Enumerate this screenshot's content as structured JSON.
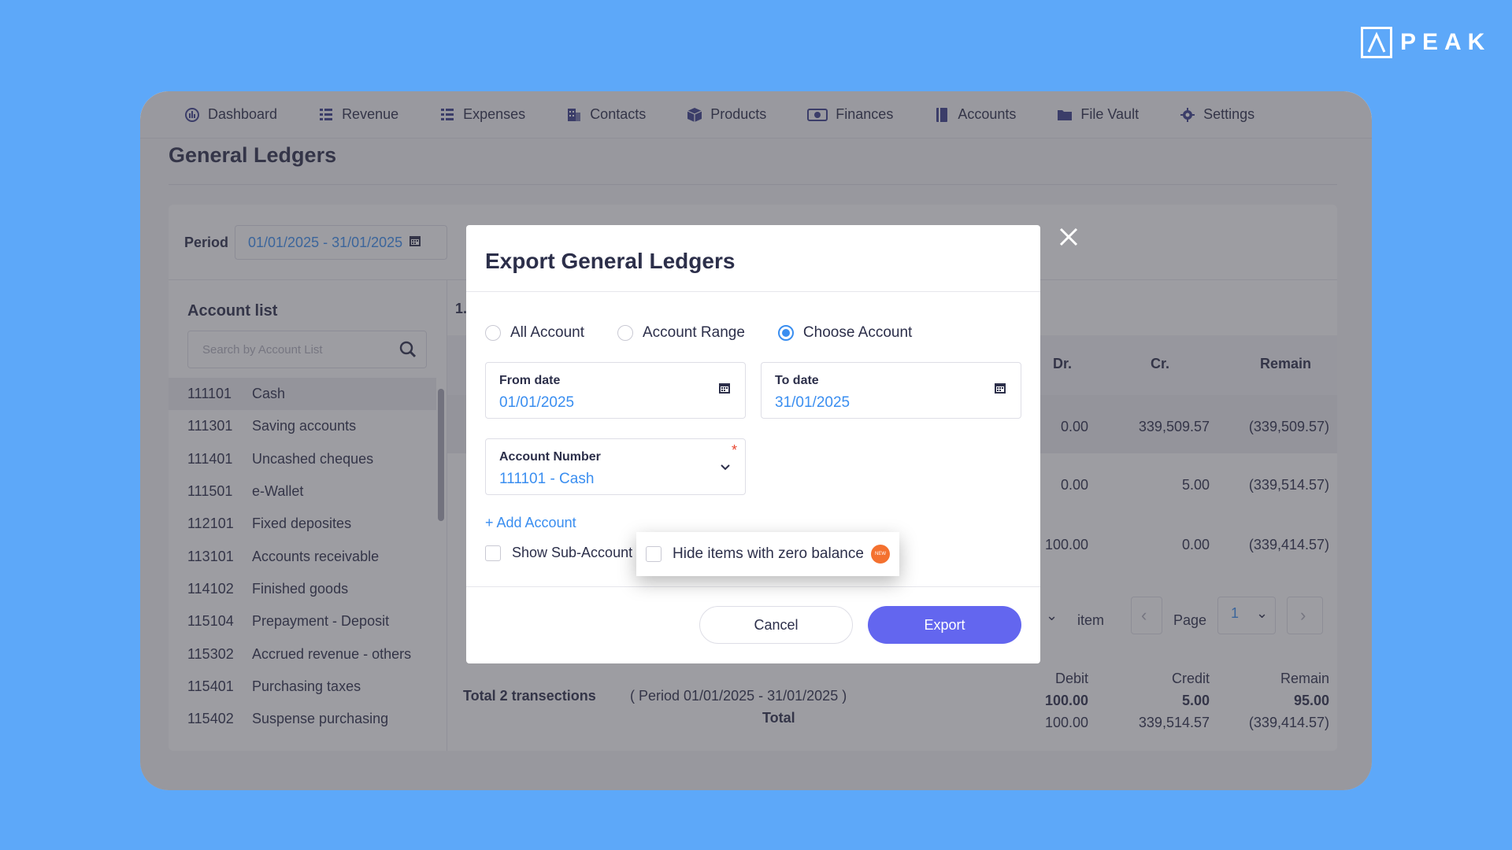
{
  "brand": {
    "logo_text": "PEAK",
    "background": "#5da8f9",
    "accent": "#6366ef",
    "link": "#3a8ef0"
  },
  "nav": {
    "items": [
      {
        "label": "Dashboard",
        "icon": "dashboard-icon"
      },
      {
        "label": "Revenue",
        "icon": "list-icon"
      },
      {
        "label": "Expenses",
        "icon": "list-icon"
      },
      {
        "label": "Contacts",
        "icon": "building-icon"
      },
      {
        "label": "Products",
        "icon": "box-icon"
      },
      {
        "label": "Finances",
        "icon": "money-icon"
      },
      {
        "label": "Accounts",
        "icon": "book-icon"
      },
      {
        "label": "File Vault",
        "icon": "folder-icon"
      },
      {
        "label": "Settings",
        "icon": "gear-icon"
      }
    ]
  },
  "page": {
    "title": "General Ledgers"
  },
  "period": {
    "label": "Period",
    "value": "01/01/2025 - 31/01/2025"
  },
  "account_list": {
    "title": "Account list",
    "search_placeholder": "Search by Account List",
    "items": [
      {
        "code": "111101",
        "name": "Cash"
      },
      {
        "code": "111301",
        "name": "Saving accounts"
      },
      {
        "code": "111401",
        "name": "Uncashed cheques"
      },
      {
        "code": "111501",
        "name": "e-Wallet"
      },
      {
        "code": "112101",
        "name": "Fixed deposites"
      },
      {
        "code": "113101",
        "name": "Accounts receivable"
      },
      {
        "code": "114102",
        "name": "Finished goods"
      },
      {
        "code": "115104",
        "name": "Prepayment - Deposit"
      },
      {
        "code": "115302",
        "name": "Accrued revenue - others"
      },
      {
        "code": "115401",
        "name": "Purchasing taxes"
      },
      {
        "code": "115402",
        "name": "Suspense purchasing"
      }
    ]
  },
  "table": {
    "partial_header": "1.",
    "headers": {
      "dr": "Dr.",
      "cr": "Cr.",
      "remain": "Remain"
    },
    "rows": [
      {
        "dr": "0.00",
        "cr": "339,509.57",
        "remain": "(339,509.57)"
      },
      {
        "dr": "0.00",
        "cr": "5.00",
        "remain": "(339,514.57)"
      },
      {
        "dr": "100.00",
        "cr": "0.00",
        "remain": "(339,414.57)"
      }
    ],
    "pager": {
      "item_label": "item",
      "page_label": "Page",
      "page_value": "1"
    },
    "summary": {
      "label": "Total 2 transections",
      "period_note": "( Period 01/01/2025 - 31/01/2025 )",
      "total_label": "Total",
      "debit_header": "Debit",
      "credit_header": "Credit",
      "remain_header": "Remain",
      "period_debit": "100.00",
      "period_credit": "5.00",
      "period_remain": "95.00",
      "total_debit": "100.00",
      "total_credit": "339,514.57",
      "total_remain": "(339,414.57)"
    }
  },
  "modal": {
    "title": "Export General Ledgers",
    "radios": [
      {
        "label": "All Account",
        "checked": false
      },
      {
        "label": "Account Range",
        "checked": false
      },
      {
        "label": "Choose Account",
        "checked": true
      }
    ],
    "from_date": {
      "label": "From date",
      "value": "01/01/2025"
    },
    "to_date": {
      "label": "To date",
      "value": "31/01/2025"
    },
    "account_number": {
      "label": "Account Number",
      "value": "111101 - Cash",
      "required_mark": "*"
    },
    "add_account": "+ Add Account",
    "show_sub_account": "Show Sub-Account",
    "hide_zero_balance": "Hide items with zero balance",
    "new_badge": "NEW",
    "cancel": "Cancel",
    "export": "Export"
  }
}
